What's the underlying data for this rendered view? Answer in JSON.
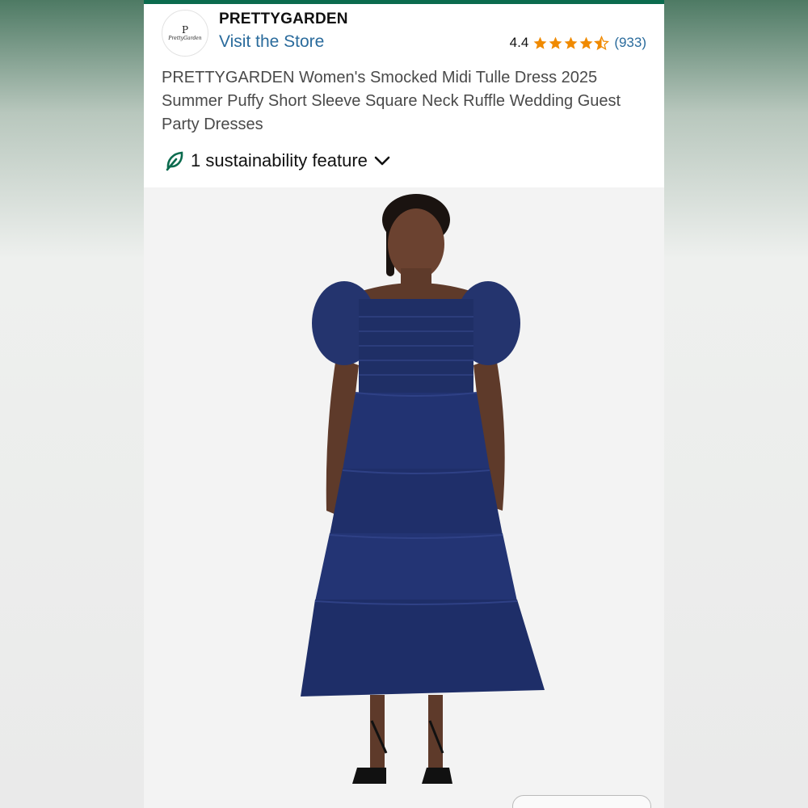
{
  "store": {
    "logo_monogram": "P",
    "logo_text": "PrettyGarden",
    "name": "PRETTYGARDEN",
    "visit_label": "Visit the Store"
  },
  "rating": {
    "value": "4.4",
    "stars_filled": 4.4,
    "stars_total": 5,
    "count": "(933)",
    "star_color": "#f08a00"
  },
  "product": {
    "title": "PRETTYGARDEN Women's Smocked Midi Tulle Dress 2025 Summer Puffy Short Sleeve Square Neck Ruffle Wedding Guest Party Dresses",
    "image_description": "product-photo"
  },
  "sustainability": {
    "icon": "leaf-icon",
    "label": "1 sustainability feature",
    "expand_icon": "chevron-down-icon",
    "accent": "#0b6b4e"
  },
  "colors": {
    "link": "#2a6b9c",
    "topbar": "#0b6b4e",
    "dress": "#1f2f66"
  }
}
